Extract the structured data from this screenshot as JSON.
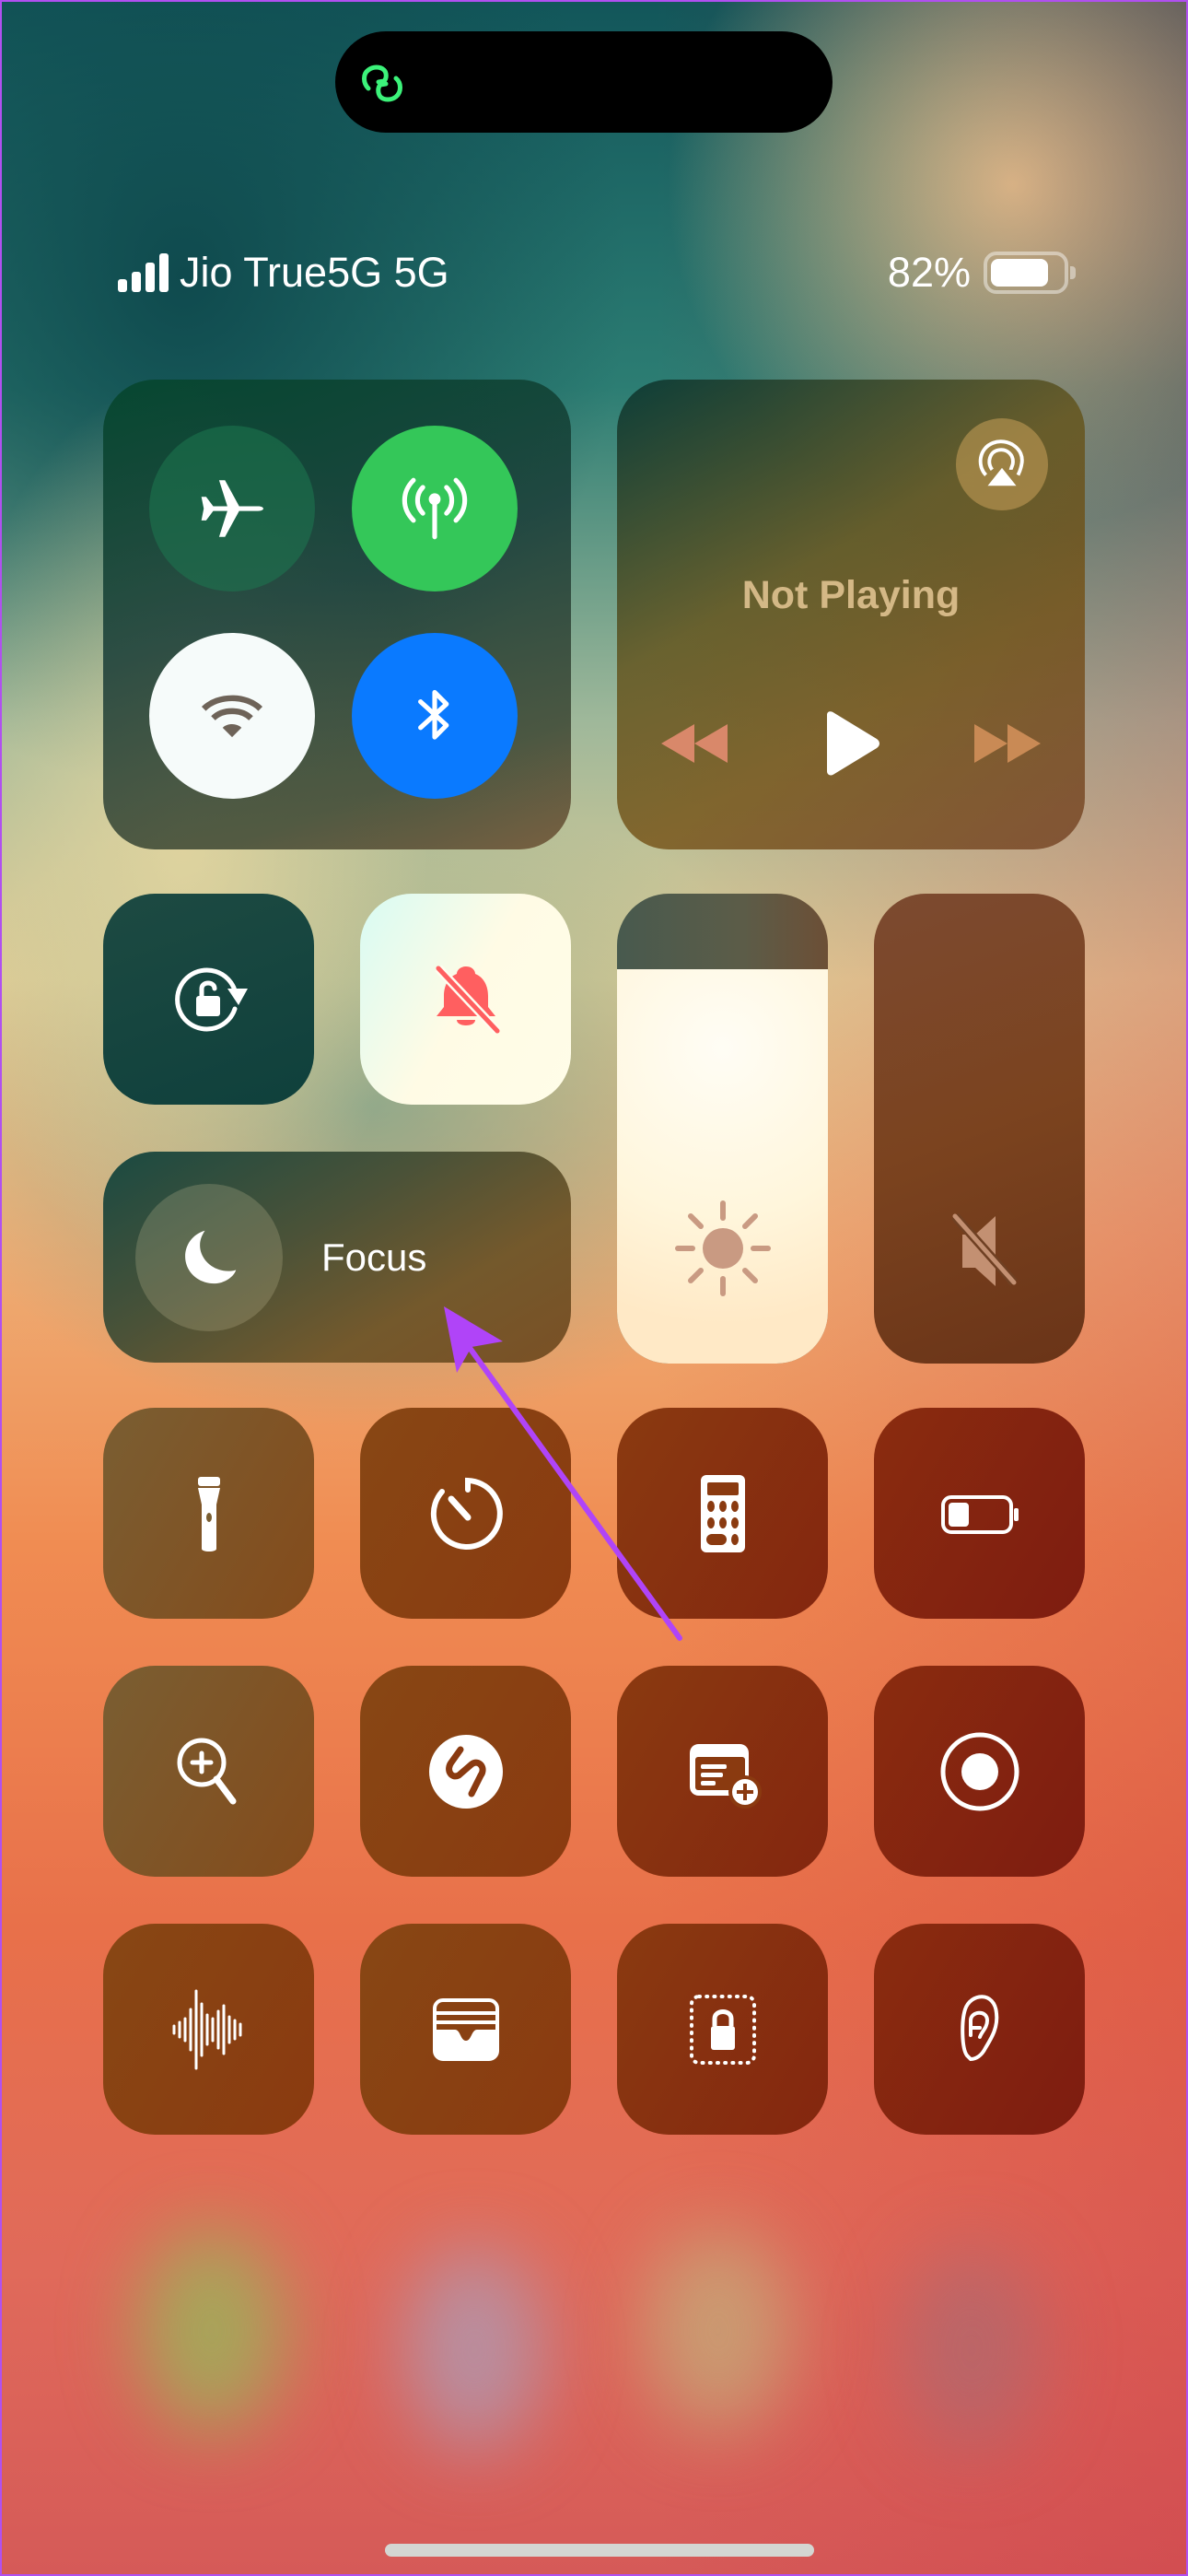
{
  "dynamic_island": {
    "activity_icon": "link-icon",
    "activity_color": "#3cf27a"
  },
  "status_bar": {
    "carrier": "Jio True5G 5G",
    "signal_bars": 4,
    "battery_percent_label": "82%",
    "battery_level": 0.82
  },
  "connectivity": {
    "airplane_mode": {
      "label": "Airplane Mode",
      "icon": "airplane-icon",
      "on": false
    },
    "cellular_data": {
      "label": "Cellular Data",
      "icon": "antenna-icon",
      "on": true,
      "color": "#34c759"
    },
    "wifi": {
      "label": "Wi-Fi",
      "icon": "wifi-icon",
      "on": true
    },
    "bluetooth": {
      "label": "Bluetooth",
      "icon": "bluetooth-icon",
      "on": true,
      "color": "#0a7aff"
    }
  },
  "now_playing": {
    "title": "Not Playing",
    "airplay_icon": "airplay-icon",
    "controls": [
      "rewind-icon",
      "play-icon",
      "fast-forward-icon"
    ]
  },
  "toggles": {
    "orientation_lock": {
      "label": "Orientation Lock",
      "icon": "rotation-lock-icon"
    },
    "silent_mode": {
      "label": "Silent Mode",
      "icon": "bell-slash-icon",
      "on": true,
      "icon_color": "#ff5a5f"
    },
    "focus": {
      "label": "Focus",
      "icon": "moon-icon"
    }
  },
  "sliders": {
    "brightness": {
      "label": "Brightness",
      "icon": "sun-icon",
      "level": 0.84
    },
    "volume": {
      "label": "Volume",
      "icon": "speaker-muted-icon",
      "level": 0.0
    }
  },
  "tiles": [
    {
      "id": "flashlight",
      "label": "Flashlight",
      "icon": "flashlight-icon"
    },
    {
      "id": "timer",
      "label": "Timer",
      "icon": "timer-icon"
    },
    {
      "id": "calculator",
      "label": "Calculator",
      "icon": "calculator-icon"
    },
    {
      "id": "low-power-mode",
      "label": "Low Power Mode",
      "icon": "battery-icon"
    },
    {
      "id": "magnifier",
      "label": "Magnifier",
      "icon": "magnifier-icon"
    },
    {
      "id": "shazam",
      "label": "Music Recognition",
      "icon": "shazam-icon"
    },
    {
      "id": "quick-note",
      "label": "Quick Note",
      "icon": "quick-note-icon"
    },
    {
      "id": "screen-recording",
      "label": "Screen Recording",
      "icon": "record-icon"
    },
    {
      "id": "voice-memos",
      "label": "Voice Memos",
      "icon": "waveform-icon"
    },
    {
      "id": "wallet",
      "label": "Wallet",
      "icon": "wallet-icon"
    },
    {
      "id": "guided-access",
      "label": "Guided Access",
      "icon": "guided-access-icon"
    },
    {
      "id": "hearing",
      "label": "Hearing",
      "icon": "ear-icon"
    }
  ],
  "annotation": {
    "type": "arrow",
    "color": "#b044f8",
    "points_to": "focus"
  }
}
